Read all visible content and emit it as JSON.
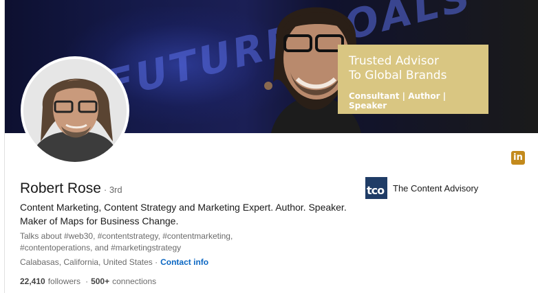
{
  "banner": {
    "background_text": "FUTURE GOALS",
    "badge_title_line1": "Trusted Advisor",
    "badge_title_line2": "To Global Brands",
    "badge_subtitle": "Consultant | Author | Speaker"
  },
  "profile": {
    "name": "Robert Rose",
    "degree": "· 3rd",
    "headline": "Content Marketing, Content Strategy and Marketing Expert. Author. Speaker. Maker of Maps for Business Change.",
    "talks_about": "Talks about #web30, #contentstrategy, #contentmarketing, #contentoperations, and #marketingstrategy",
    "location": "Calabasas, California, United States ·",
    "contact_label": "Contact info",
    "followers_count": "22,410",
    "followers_label": "followers",
    "separator": "·",
    "connections_count": "500+",
    "connections_label": "connections"
  },
  "company": {
    "logo_text": "tco",
    "name": "The Content Advisory"
  },
  "icons": {
    "linkedin_badge": "in"
  },
  "colors": {
    "link": "#0a66c2",
    "badge": "#d9c682",
    "linkedin_icon": "#c38a1c"
  }
}
